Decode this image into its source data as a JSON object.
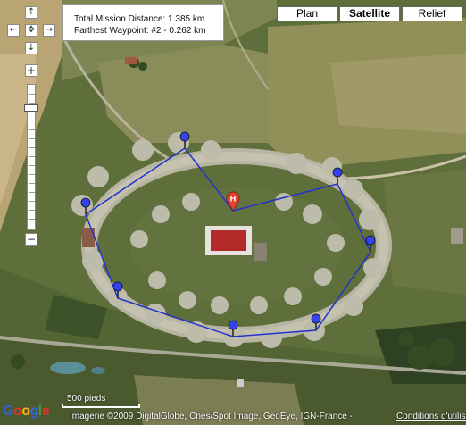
{
  "info": {
    "distance": "Total Mission Distance: 1.385 km",
    "farthest": "Farthest Waypoint: #2 - 0.262 km"
  },
  "map_types": [
    "Plan",
    "Satellite",
    "Relief"
  ],
  "active_map_type": "Satellite",
  "controls": {
    "pan_up": "↑",
    "pan_left": "←",
    "pan_center": "✥",
    "pan_right": "→",
    "pan_down": "↓",
    "zoom_in": "+",
    "zoom_out": "−"
  },
  "scale_label": "500 pieds",
  "copyright": "Imagerie ©2009 DigitalGlobe, Cnes/Spot Image, GeoEye, IGN-France -",
  "terms": "Conditions d'utilisation",
  "home_marker_label": "H",
  "route_color": "#2233cc",
  "marker_color": "#3344ee",
  "home_marker_color": "#e2422e",
  "icons": {
    "waypoint": "waypoint-marker-icon",
    "home": "home-marker-icon"
  }
}
